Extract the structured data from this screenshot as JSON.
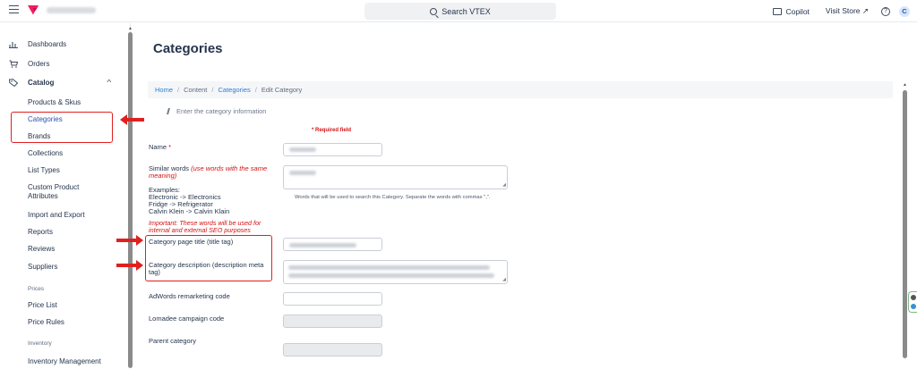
{
  "topbar": {
    "search_label": "Search VTEX",
    "copilot_label": "Copilot",
    "visit_store_label": "Visit Store ↗",
    "help_glyph": "?",
    "avatar_letter": "C",
    "brand_color": "#f71963"
  },
  "sidebar": {
    "dashboards": "Dashboards",
    "orders": "Orders",
    "catalog": "Catalog",
    "catalog_items": [
      "Products & Skus",
      "Categories",
      "Brands",
      "Collections",
      "List Types",
      "Custom Product Attributes",
      "Import and Export",
      "Reports",
      "Reviews",
      "Suppliers"
    ],
    "prices_section": "Prices",
    "price_items": [
      "Price List",
      "Price Rules"
    ],
    "inventory_section": "Inventory",
    "inventory_items": [
      "Inventory Management"
    ]
  },
  "main": {
    "title": "Categories",
    "breadcrumb": [
      "Home",
      "Content",
      "Categories",
      "Edit Category"
    ],
    "info_hint": "Enter the category information",
    "required_note": "* Required field",
    "fields": {
      "name_label": "Name",
      "name_star": "*",
      "similar_label": "Similar words",
      "similar_note": "(use words with the same meaning)",
      "examples": [
        "Examples:",
        "Electronic -> Electronics",
        "Fridge -> Refrigerator",
        "Calvin Klein -> Calvin Klain"
      ],
      "important": "Important: These words will be used for internal and external SEO purposes",
      "similar_hint": "Words that will be used to search this Category. Separate the words with commas \",\".",
      "title_tag_label": "Category page title (title tag)",
      "description_label": "Category description (description meta tag)",
      "adwords_label": "AdWords remarketing code",
      "lomadee_label": "Lomadee campaign code",
      "parent_label": "Parent category"
    }
  },
  "colors": {
    "link": "#2a7fd6",
    "required": "#d31212",
    "annotation": "#e02020"
  }
}
